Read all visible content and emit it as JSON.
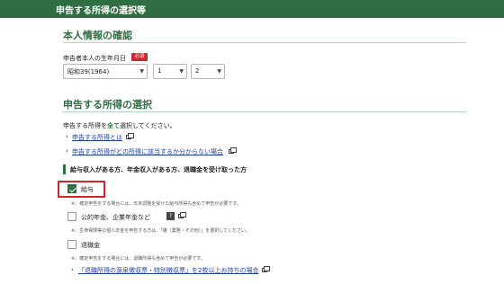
{
  "header": {
    "title": "申告する所得の選択等"
  },
  "section_personal": {
    "title": "本人情報の確認",
    "birthdate_label": "申告者本人の生年月日",
    "required_badge": "必須",
    "era_year": "昭和39(1964)",
    "month": "1",
    "day": "2"
  },
  "section_income": {
    "title": "申告する所得の選択",
    "instruction_pre": "申告する所得を",
    "instruction_all": "全て",
    "instruction_post": "選択してください。",
    "link1": "申告する所得とは",
    "link2": "申告する所得がどの所得に該当するか分からない場合",
    "group_heading": "給与収入がある方、年金収入がある方、退職金を受け取った方",
    "items": [
      {
        "label": "給与",
        "checked": true,
        "note": "※：確定申告をする場合には、年末調整を受けた給与所得も含めて申告が必要です。"
      },
      {
        "label": "公的年金、企業年金など",
        "checked": false,
        "help": "?",
        "note": "※：生命保険等の個人年金を申告する方は、「雑（業務・その他）」を選択してください。"
      },
      {
        "label": "退職金",
        "checked": false,
        "note": "※：確定申告をする場合には、退職所得も含めて申告が必要です。"
      }
    ],
    "bottom_link_prefix": "「",
    "bottom_link": "「退職所得の源泉徴収票・特別徴収票」を2枚以上お持ちの場合"
  },
  "colors": {
    "brand_green": "#2f6e42",
    "alert_red": "#d0262f",
    "link_blue": "#1f3f9f"
  }
}
